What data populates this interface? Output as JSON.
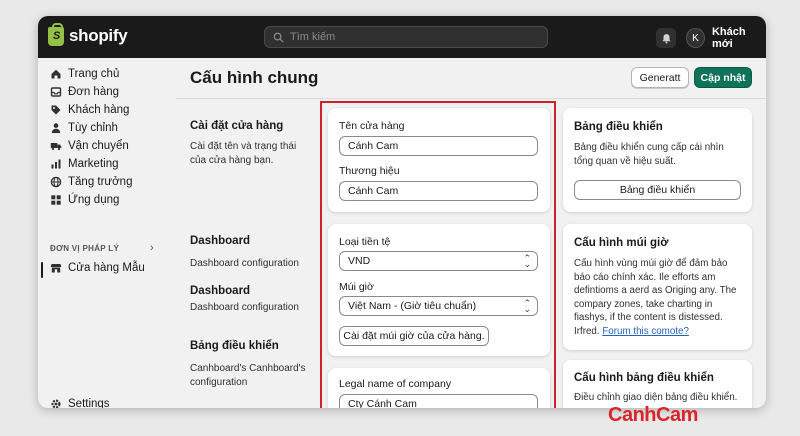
{
  "topbar": {
    "logo_text": "shopify",
    "logo_mark": "S",
    "search_placeholder": "Tìm kiếm",
    "user_initial": "K",
    "user_name": "Khách mới"
  },
  "sidebar": {
    "items": [
      {
        "label": "Trang chủ",
        "icon": "home-icon"
      },
      {
        "label": "Đơn hàng",
        "icon": "inbox-icon"
      },
      {
        "label": "Khách hàng",
        "icon": "tag-icon"
      },
      {
        "label": "Tùy chỉnh",
        "icon": "person-icon"
      },
      {
        "label": "Vận chuyển",
        "icon": "truck-icon"
      },
      {
        "label": "Marketing",
        "icon": "chart-icon"
      },
      {
        "label": "Tăng trưởng",
        "icon": "globe-icon"
      },
      {
        "label": "Ứng dụng",
        "icon": "apps-icon"
      }
    ],
    "section_label": "ĐƠN VỊ PHÁP LÝ",
    "store_item": "Cửa hàng Mẫu",
    "settings": "Settings"
  },
  "page": {
    "title": "Cấu hình chung",
    "btn_secondary": "Generatt",
    "btn_primary": "Cập nhật"
  },
  "sections": {
    "store": {
      "title": "Cài đặt cửa hàng",
      "desc": "Cài đặt tên và trạng thái của cửa hàng bạn."
    },
    "dashboard1": {
      "title": "Dashboard",
      "desc": "Dashboard configuration"
    },
    "dashboard2": {
      "title": "Dashboard",
      "desc": "Dashboard configuration"
    },
    "panel": {
      "title": "Bảng điều khiển",
      "desc": "Canhboard's Canhboard's configuration"
    }
  },
  "form": {
    "store_name_label": "Tên cửa hàng",
    "store_name_value": "Cánh Cam",
    "brand_label": "Thương hiệu",
    "brand_value": "Cánh Cam",
    "currency_label": "Loại tiền tệ",
    "currency_value": "VND",
    "timezone_label": "Múi giờ",
    "timezone_value": "Việt Nam - (Giờ tiêu chuẩn)",
    "timezone_button": "Cài đặt múi giờ của cửa hàng.",
    "legal_label": "Legal name of company",
    "legal_value": "Cty Cánh Cam"
  },
  "right_cards": {
    "card1": {
      "title": "Bảng điều khiển",
      "text": "Bảng điều khiển cung cấp cái nhìn tổng quan về hiệu suất.",
      "button": "Bảng điều khiển"
    },
    "card2": {
      "title": "Cấu hình múi giờ",
      "text": "Cấu hình vùng múi giờ để đảm bảo báo cáo chính xác. Ile efforts am defintioms a aerd as Origing any. The compary zones, take charting in fiashys, if the content is distessed. Irfred.",
      "link": "Forum this comote?"
    },
    "card3": {
      "title": "Cấu hình bảng điều khiển",
      "text": "Điều chỉnh giao diện bảng điều khiển."
    }
  },
  "watermark": "CanhCam",
  "colors": {
    "primary": "#0e7359",
    "highlight": "#d0222a",
    "link": "#2463bc",
    "topbar": "#1a1a1a"
  }
}
